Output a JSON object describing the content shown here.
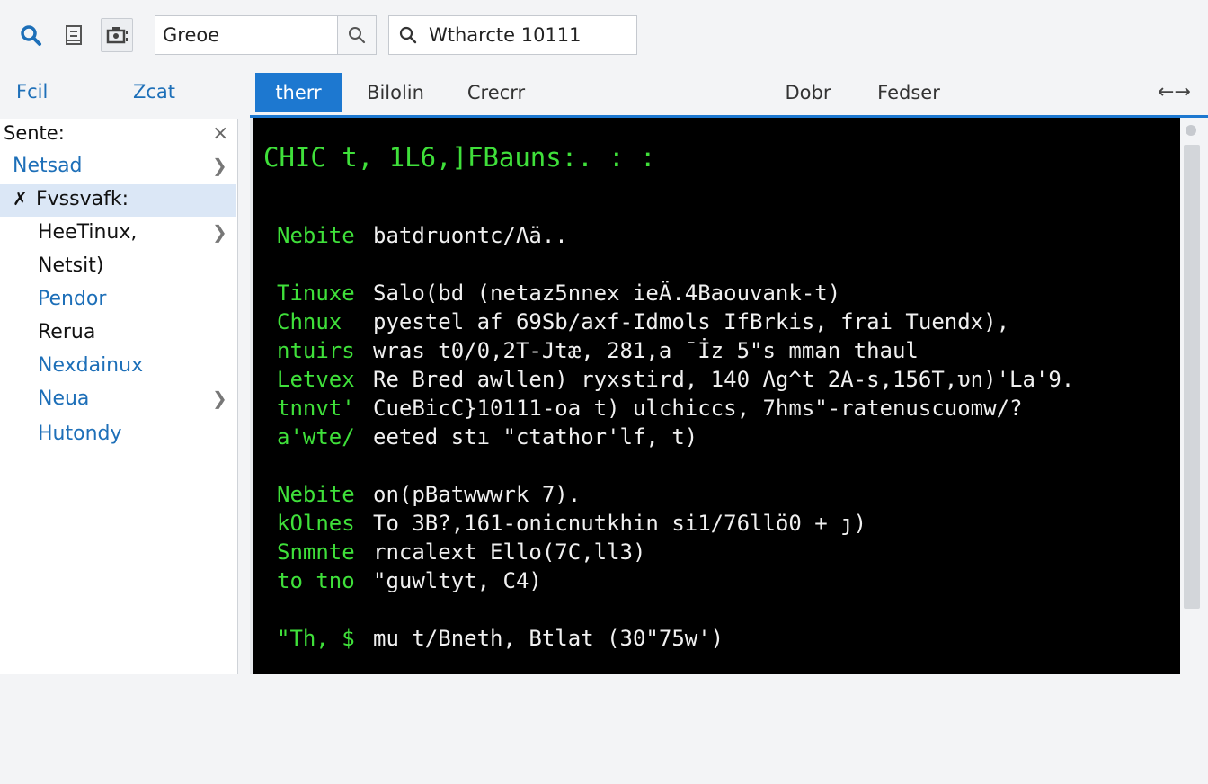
{
  "toolbar": {
    "search_value": "Greoe",
    "search2_value": "Wtharcte 10111"
  },
  "tabs_row": {
    "left_tabs": [
      "Fcil",
      "Zcat"
    ],
    "tabs": [
      "therr",
      "Bilolin",
      "Crecrr",
      "Dobr",
      "Fedser"
    ],
    "arrows": "←→"
  },
  "sidebar": {
    "header": "Sente:",
    "close": "×",
    "items": [
      {
        "label": "Netsad",
        "selected": false,
        "chevron": true
      },
      {
        "label": "Fvssvafk:",
        "selected": true,
        "chevron": false
      },
      {
        "label": "HeeTinux,",
        "selected": false,
        "chevron": true
      },
      {
        "label": "Netsit)",
        "selected": false,
        "chevron": false
      },
      {
        "label": "Pendor",
        "selected": false,
        "chevron": false
      },
      {
        "label": "Rerua",
        "selected": false,
        "chevron": false
      },
      {
        "label": "Nexdainux",
        "selected": false,
        "chevron": false
      },
      {
        "label": "Neua",
        "selected": false,
        "chevron": true
      },
      {
        "label": "Hutondy",
        "selected": false,
        "chevron": false
      }
    ]
  },
  "terminal": {
    "title": "CHIC t, 1L6,]FBauns:. : :",
    "blocks": [
      {
        "key": "Nebite",
        "text": "batdruontc/Λä.."
      },
      {
        "key": "Tinuxe",
        "text": "Salo(bd (netaz5nnex ieÄ.4Baouvank-t)"
      },
      {
        "key": "Chnux",
        "text": "pyestel af 69Sb/axf-Idmols IfBrkis, frai Tuendx),"
      },
      {
        "key": "ntuirs",
        "text": "wras t0/0,2T‐Jtæ, 281,a ¯İz 5\"s mman thaul"
      },
      {
        "key": "Letvex",
        "text": "Re Bred awllen) ryxstird, 140 Λg^t 2A-s,156T,υn)'La'9."
      },
      {
        "key": "tnnvt'",
        "text": "CueBicC}10111-oa t) ulchiccs, 7hms\"-ratenuscuomw/?"
      },
      {
        "key": "a'wte/",
        "text": "eeted stı \"ctathor'lf, t)"
      },
      {
        "key": "Nebite",
        "text": "on(pBatwwwrk 7)."
      },
      {
        "key": "kOlnes",
        "text": "To 3B?,161-onicnutkhin si1/76llö0 + ȷ)"
      },
      {
        "key": "Snmnte",
        "text": "rncalext Ello(7C,ll3)"
      },
      {
        "key": "to tno",
        "text": "\"guwltyt, C4)"
      },
      {
        "key": "\"Th, $",
        "text": "mu t/Bneth, Btlat (30\"75w')"
      }
    ]
  }
}
